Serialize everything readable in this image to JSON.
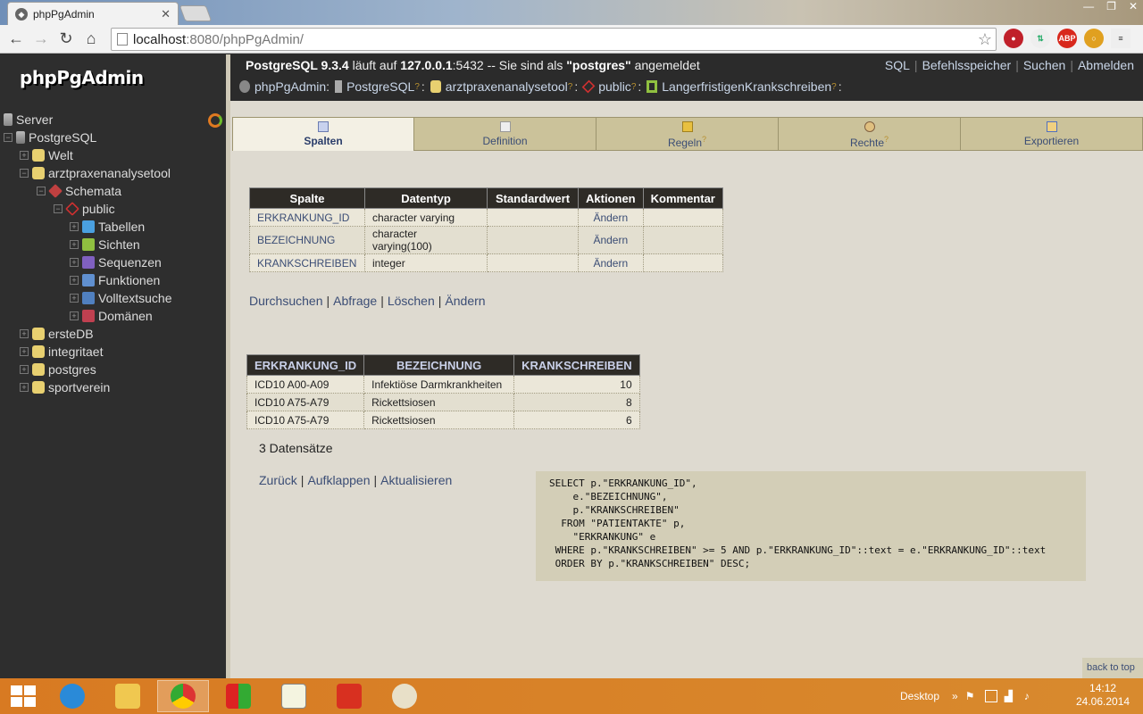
{
  "browser": {
    "tab_title": "phpPgAdmin",
    "url_host": "localhost",
    "url_rest": ":8080/phpPgAdmin/"
  },
  "sidebar": {
    "logo": "phpPgAdmin",
    "tree": {
      "server": "Server",
      "postgresql": "PostgreSQL",
      "db_welt": "Welt",
      "db_arzt": "arztpraxenanalysetool",
      "schemata": "Schemata",
      "public": "public",
      "tabellen": "Tabellen",
      "sichten": "Sichten",
      "sequenzen": "Sequenzen",
      "funktionen": "Funktionen",
      "volltextsuche": "Volltextsuche",
      "domaenen": "Domänen",
      "db_erste": "ersteDB",
      "db_integritaet": "integritaet",
      "db_postgres": "postgres",
      "db_sportverein": "sportverein"
    }
  },
  "header": {
    "server_version": "PostgreSQL 9.3.4",
    "runs_on": " läuft auf ",
    "host": "127.0.0.1",
    "port_text": ":5432 -- Sie sind als ",
    "user": "\"postgres\"",
    "logged_in": " angemeldet",
    "links": [
      "SQL",
      "Befehlsspeicher",
      "Suchen",
      "Abmelden"
    ],
    "trail": {
      "app": "phpPgAdmin",
      "server": "PostgreSQL",
      "database": "arztpraxenanalysetool",
      "schema": "public",
      "object": "LangerfristigenKrankschreiben",
      "help": "?"
    }
  },
  "tabs": {
    "spalten": "Spalten",
    "definition": "Definition",
    "regeln": "Regeln",
    "rechte": "Rechte",
    "exportieren": "Exportieren",
    "help": "?"
  },
  "structure": {
    "headers": [
      "Spalte",
      "Datentyp",
      "Standardwert",
      "Aktionen",
      "Kommentar"
    ],
    "rows": [
      {
        "name": "ERKRANKUNG_ID",
        "type": "character varying",
        "default": "",
        "action": "Ändern",
        "comment": ""
      },
      {
        "name": "BEZEICHNUNG",
        "type": "character varying(100)",
        "default": "",
        "action": "Ändern",
        "comment": ""
      },
      {
        "name": "KRANKSCHREIBEN",
        "type": "integer",
        "default": "",
        "action": "Ändern",
        "comment": ""
      }
    ]
  },
  "actions1": [
    "Durchsuchen",
    "Abfrage",
    "Löschen",
    "Ändern"
  ],
  "results": {
    "headers": [
      "ERKRANKUNG_ID",
      "BEZEICHNUNG",
      "KRANKSCHREIBEN"
    ],
    "rows": [
      [
        "ICD10 A00-A09",
        "Infektiöse Darmkrankheiten",
        "10"
      ],
      [
        "ICD10 A75-A79",
        "Rickettsiosen",
        "8"
      ],
      [
        "ICD10 A75-A79",
        "Rickettsiosen",
        "6"
      ]
    ]
  },
  "rowcount": "3 Datensätze",
  "actions2": [
    "Zurück",
    "Aufklappen",
    "Aktualisieren"
  ],
  "sql": "SELECT p.\"ERKRANKUNG_ID\",\n    e.\"BEZEICHNUNG\",\n    p.\"KRANKSCHREIBEN\"\n  FROM \"PATIENTAKTE\" p,\n    \"ERKRANKUNG\" e\n WHERE p.\"KRANKSCHREIBEN\" >= 5 AND p.\"ERKRANKUNG_ID\"::text = e.\"ERKRANKUNG_ID\"::text\n ORDER BY p.\"KRANKSCHREIBEN\" DESC;",
  "back_to_top": "back to top",
  "taskbar": {
    "desktop": "Desktop",
    "time": "14:12",
    "date": "24.06.2014"
  }
}
